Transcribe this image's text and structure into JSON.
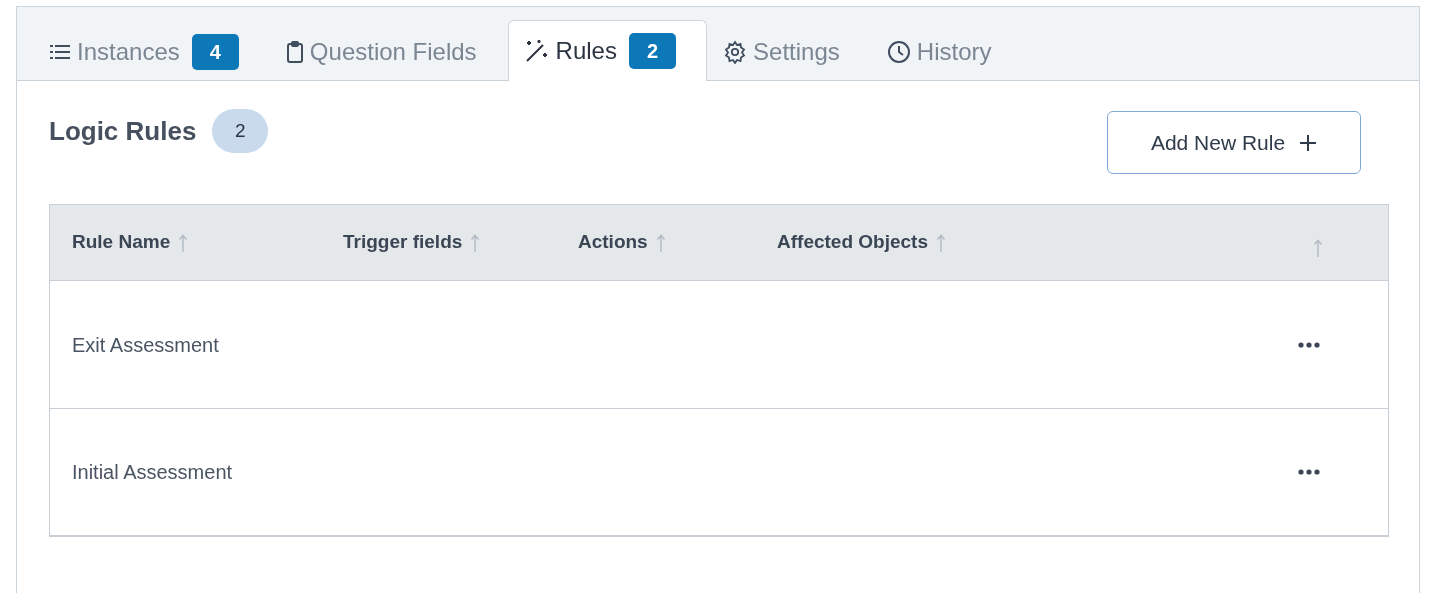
{
  "tabs": [
    {
      "label": "Instances",
      "badge": "4",
      "selected": false
    },
    {
      "label": "Question Fields",
      "selected": false
    },
    {
      "label": "Rules",
      "badge": "2",
      "selected": true
    },
    {
      "label": "Settings",
      "selected": false
    },
    {
      "label": "History",
      "selected": false
    }
  ],
  "heading": {
    "title": "Logic Rules",
    "count": "2"
  },
  "add_button": {
    "label": "Add New Rule"
  },
  "table": {
    "columns": [
      {
        "kind": "text",
        "label": "Rule Name"
      },
      {
        "kind": "text",
        "label": "Trigger fields"
      },
      {
        "kind": "text",
        "label": "Actions"
      },
      {
        "kind": "text",
        "label": "Affected Objects"
      },
      {
        "kind": "menu"
      }
    ],
    "rows": [
      {
        "name": "Exit Assessment"
      },
      {
        "name": "Initial Assessment"
      }
    ]
  }
}
